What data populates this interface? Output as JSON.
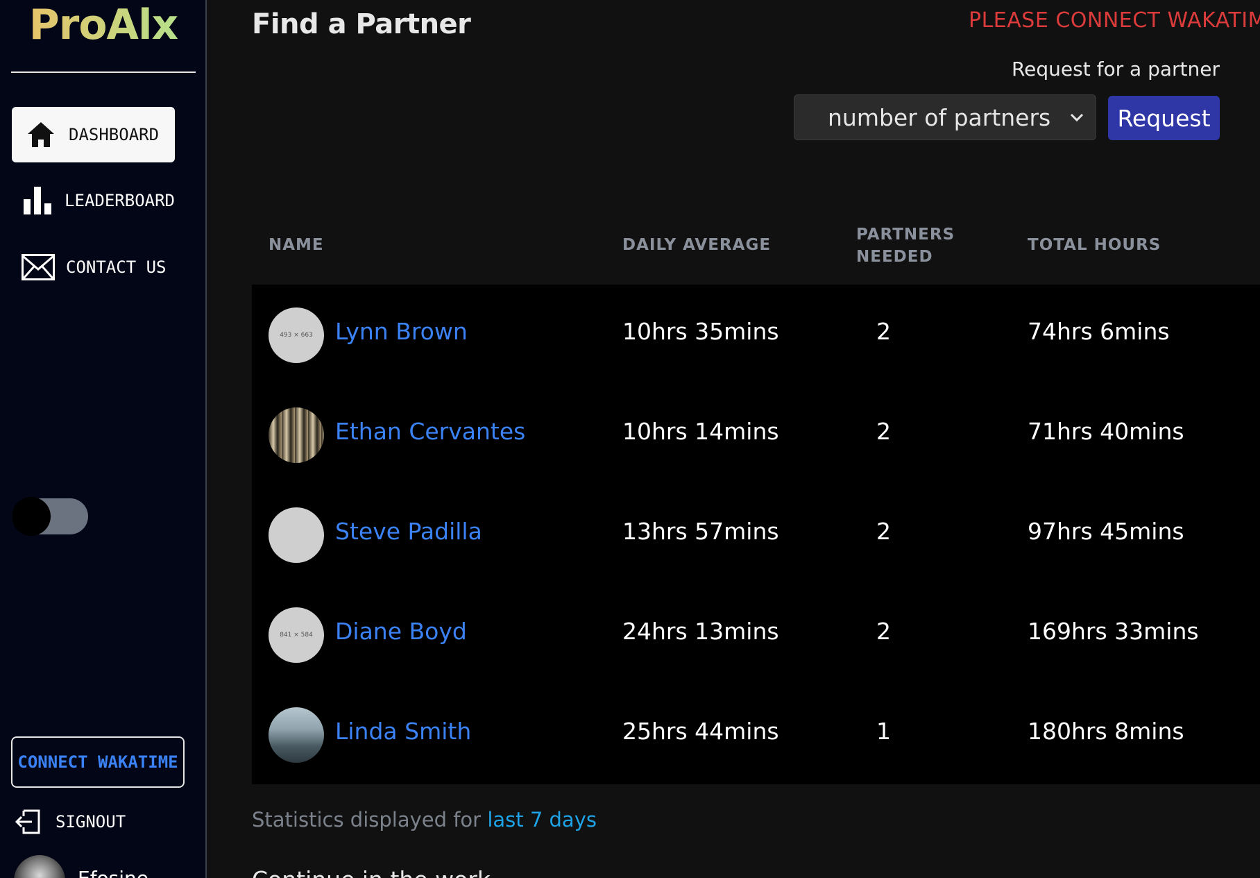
{
  "app": {
    "logo": "ProAlx"
  },
  "sidebar": {
    "items": [
      {
        "label": "DASHBOARD",
        "icon": "home-icon",
        "active": true
      },
      {
        "label": "LEADERBOARD",
        "icon": "bar-chart-icon",
        "active": false
      },
      {
        "label": "CONTACT US",
        "icon": "mail-icon",
        "active": false
      }
    ],
    "theme_toggle": {
      "state": "dark"
    },
    "connect_label": "CONNECT WAKATIME",
    "signout_label": "SIGNOUT",
    "user_name": "Efosine"
  },
  "header": {
    "title": "Find a Partner",
    "warning": "PLEASE CONNECT WAKATIME",
    "request_label": "Request for a partner",
    "select_value": "number of partners",
    "request_button": "Request"
  },
  "table": {
    "columns": [
      "NAME",
      "DAILY AVERAGE",
      "PARTNERS NEEDED",
      "TOTAL HOURS"
    ],
    "rows": [
      {
        "name": "Lynn Brown",
        "daily": "10hrs 35mins",
        "needed": "2",
        "total": "74hrs 6mins",
        "avatar_text": "493 × 663"
      },
      {
        "name": "Ethan Cervantes",
        "daily": "10hrs 14mins",
        "needed": "2",
        "total": "71hrs 40mins",
        "avatar_text": ""
      },
      {
        "name": "Steve Padilla",
        "daily": "13hrs 57mins",
        "needed": "2",
        "total": "97hrs 45mins",
        "avatar_text": ""
      },
      {
        "name": "Diane Boyd",
        "daily": "24hrs 13mins",
        "needed": "2",
        "total": "169hrs 33mins",
        "avatar_text": "841 × 584"
      },
      {
        "name": "Linda Smith",
        "daily": "25hrs 44mins",
        "needed": "1",
        "total": "180hrs 8mins",
        "avatar_text": ""
      }
    ]
  },
  "footer": {
    "stats_prefix": "Statistics displayed for",
    "stats_period": "last 7 days",
    "next_heading": "Continue in the work"
  },
  "colors": {
    "accent": "#3b82f6",
    "warning": "#dc3b3b",
    "request_button": "#2f37a6",
    "sidebar_bg": "#020617"
  }
}
